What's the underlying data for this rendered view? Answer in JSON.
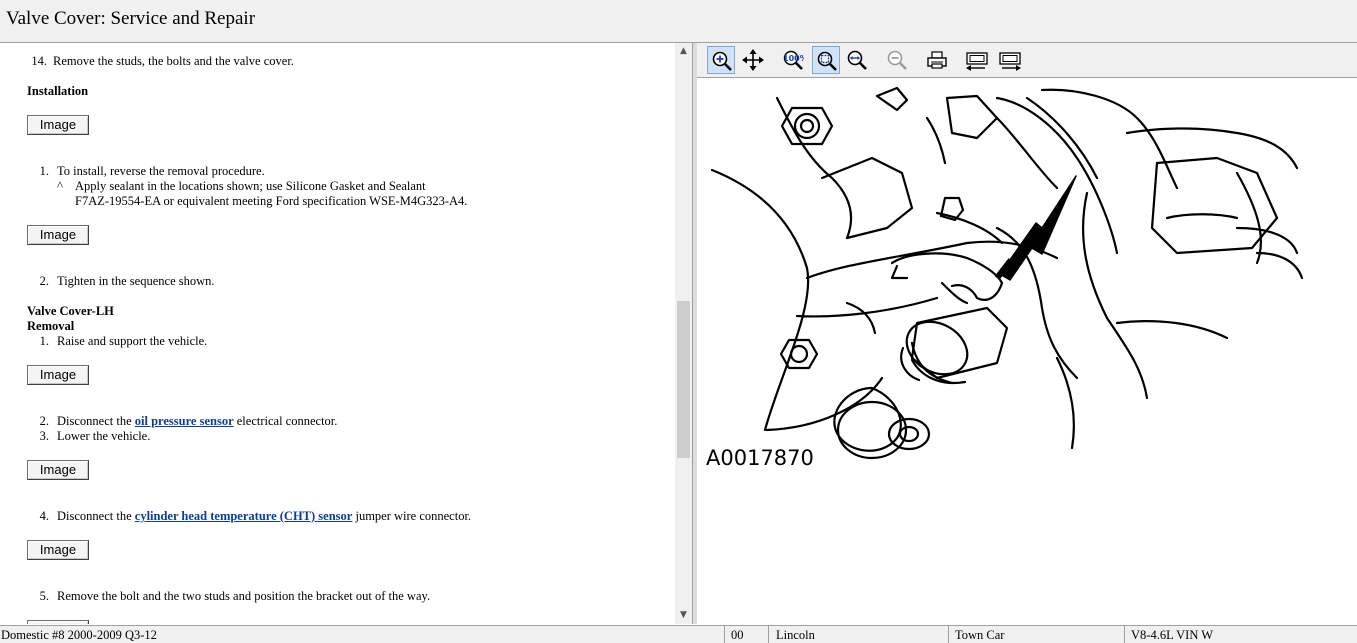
{
  "window": {
    "title": "Valve Cover:  Service and Repair"
  },
  "content": {
    "step14_num": "14.",
    "step14_text": "Remove the studs, the bolts and the valve cover.",
    "installation_heading": "Installation",
    "image_button_label": "Image",
    "inst1_num": "1.",
    "inst1_text": "To install, reverse the removal procedure.",
    "inst1_bullet": "^",
    "inst1_sub_line1": "Apply sealant in the locations shown; use Silicone Gasket and Sealant",
    "inst1_sub_line2": "F7AZ-19554-EA or equivalent meeting Ford specification WSE-M4G323-A4.",
    "inst2_num": "2.",
    "inst2_text": "Tighten in the sequence shown.",
    "lh_heading": "Valve Cover-LH",
    "removal_heading": "Removal",
    "rem1_num": "1.",
    "rem1_text": "Raise and support the vehicle.",
    "rem2_num": "2.",
    "rem2_pre": "Disconnect the ",
    "rem2_link": "oil pressure sensor",
    "rem2_post": " electrical connector.",
    "rem3_num": "3.",
    "rem3_text": "Lower the vehicle.",
    "rem4_num": "4.",
    "rem4_pre": "Disconnect the ",
    "rem4_link": "cylinder head temperature (CHT) sensor",
    "rem4_post": " jumper wire connector.",
    "rem5_num": "5.",
    "rem5_text": "Remove the bolt and the two studs and position the bracket out of the way."
  },
  "toolbar": {
    "zoom_level_label": "100%",
    "icons": [
      "zoom-in-icon",
      "pan-icon",
      "zoom-100-icon",
      "zoom-fit-icon",
      "zoom-width-icon",
      "zoom-out-icon",
      "print-icon",
      "prev-image-icon",
      "next-image-icon"
    ]
  },
  "figure": {
    "label": "A0017870"
  },
  "status": {
    "source": "Domestic #8 2000-2009 Q3-12",
    "code": "00",
    "make": "Lincoln",
    "model": "Town Car",
    "engine": "V8-4.6L VIN W"
  }
}
